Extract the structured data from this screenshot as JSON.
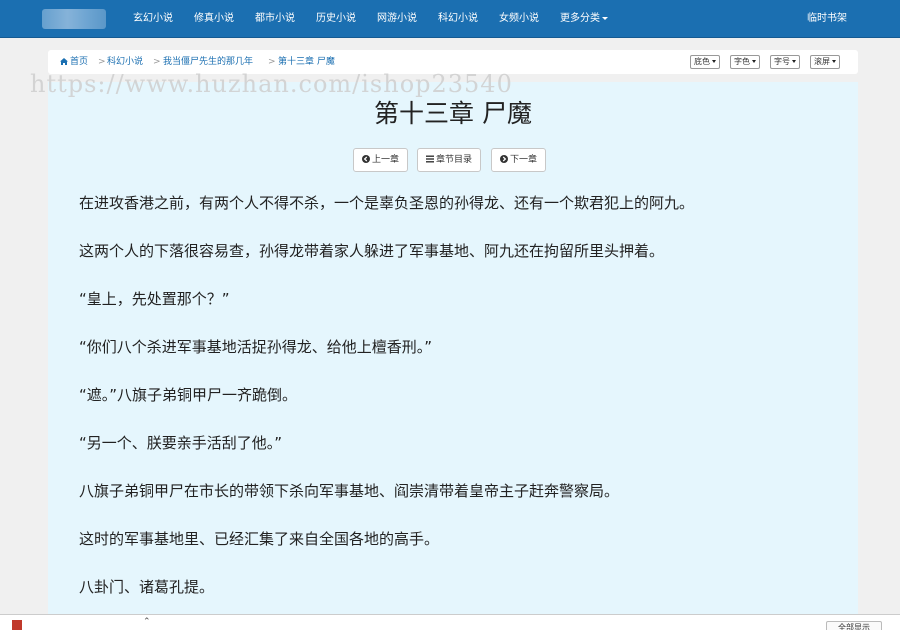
{
  "nav": {
    "items": [
      "玄幻小说",
      "修真小说",
      "都市小说",
      "历史小说",
      "网游小说",
      "科幻小说",
      "女频小说",
      "更多分类"
    ],
    "bookshelf": "临时书架"
  },
  "breadcrumb": {
    "home": "首页",
    "category": "科幻小说",
    "book": "我当僵尸先生的那几年",
    "chapter": "第十三章 尸魔",
    "sep": ">"
  },
  "settings": {
    "bg": "底色",
    "color": "字色",
    "size": "字号",
    "scroll": "滚屏"
  },
  "watermark": "https://www.huzhan.com/ishop23540",
  "chapter": {
    "title": "第十三章 尸魔",
    "prev": "上一章",
    "toc": "章节目录",
    "next": "下一章",
    "paragraphs": [
      "在进攻香港之前，有两个人不得不杀，一个是辜负圣恩的孙得龙、还有一个欺君犯上的阿九。",
      "这两个人的下落很容易查，孙得龙带着家人躲进了军事基地、阿九还在拘留所里头押着。",
      "“皇上，先处置那个？”",
      "“你们八个杀进军事基地活捉孙得龙、给他上檀香刑。”",
      "“遮。”八旗子弟铜甲尸一齐跪倒。",
      "“另一个、朕要亲手活刮了他。”",
      "八旗子弟铜甲尸在市长的带领下杀向军事基地、阎崇清带着皇帝主子赶奔警察局。",
      "这时的军事基地里、已经汇集了来自全国各地的高手。",
      "八卦门、诸葛孔提。"
    ]
  },
  "bottom": {
    "show_all": "全部显示"
  },
  "colors": {
    "navbar": "#1b6fb1",
    "reader_bg": "#e5f6fd",
    "link": "#1b6fb1"
  }
}
